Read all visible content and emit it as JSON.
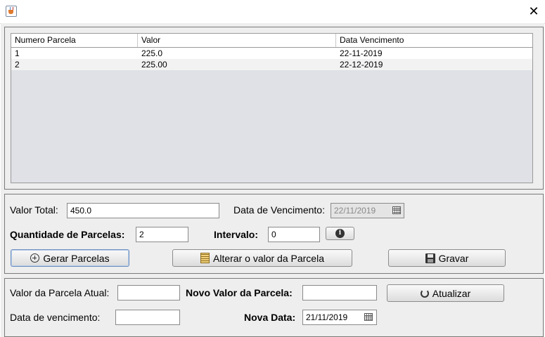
{
  "window": {
    "close_glyph": "✕"
  },
  "table": {
    "headers": [
      "Numero Parcela",
      "Valor",
      "Data Vencimento"
    ],
    "rows": [
      {
        "numero": "1",
        "valor": "225.0",
        "data": "22-11-2019"
      },
      {
        "numero": "2",
        "valor": "225.00",
        "data": "22-12-2019"
      }
    ]
  },
  "form": {
    "valor_total_label": "Valor Total:",
    "valor_total_value": "450.0",
    "data_vencimento_label": "Data de Vencimento:",
    "data_vencimento_value": "22/11/2019",
    "quantidade_label": "Quantidade de Parcelas:",
    "quantidade_value": "2",
    "intervalo_label": "Intervalo:",
    "intervalo_value": "0"
  },
  "buttons": {
    "gerar": "Gerar Parcelas",
    "alterar": "Alterar o valor da Parcela",
    "gravar": "Gravar",
    "atualizar": "Atualizar"
  },
  "edit": {
    "valor_atual_label": "Valor da Parcela Atual:",
    "valor_atual_value": "",
    "novo_valor_label": "Novo Valor da Parcela:",
    "novo_valor_value": "",
    "data_venc_label": "Data de vencimento:",
    "data_venc_value": "",
    "nova_data_label": "Nova Data:",
    "nova_data_value": "21/11/2019"
  },
  "icons": {
    "app": "java-cup-icon",
    "close": "close-icon",
    "calendar": "calendar-icon",
    "info": "info-icon",
    "gerar": "plus-circle-icon",
    "alterar": "notepad-icon",
    "gravar": "floppy-disk-icon",
    "atualizar": "refresh-icon"
  },
  "colors": {
    "background": "#eeeeee",
    "table_body": "#dfe1e6",
    "row_alt": "#f2f2f2",
    "disabled_text": "#8a8a8a"
  }
}
